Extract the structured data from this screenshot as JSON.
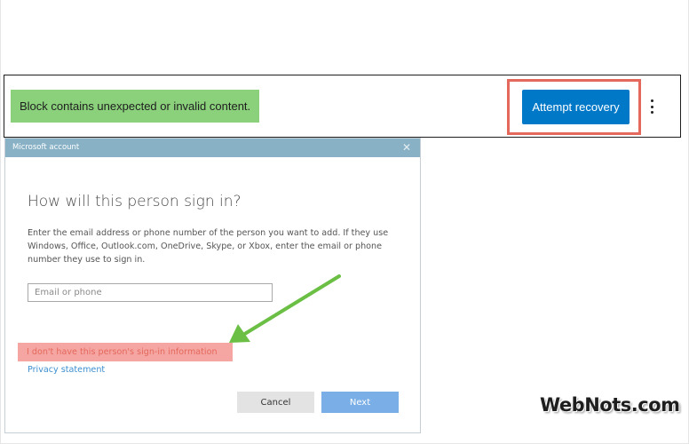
{
  "block_warning": {
    "message": "Block contains unexpected or invalid content.",
    "recovery_button_label": "Attempt recovery",
    "more_options_icon": "vertical-ellipsis-icon"
  },
  "dialog": {
    "title": "Microsoft account",
    "close_glyph": "✕",
    "heading": "How will this person sign in?",
    "description": "Enter the email address or phone number of the person you want to add. If they use Windows, Office, Outlook.com, OneDrive, Skype, or Xbox, enter the email or phone number they use to sign in.",
    "email_placeholder": "Email or phone",
    "email_value": "",
    "no_info_link": "I don't have this person's sign-in information",
    "privacy_link": "Privacy statement",
    "cancel_label": "Cancel",
    "next_label": "Next"
  },
  "colors": {
    "warning_highlight": "#8bd17c",
    "recovery_button": "#0078c8",
    "callout_border": "#e4685b",
    "titlebar": "#88b1c5",
    "link_highlight": "#f5a6a3",
    "arrow": "#6bbf45",
    "next_button": "#79aee6"
  },
  "watermark": "WebNots.com"
}
